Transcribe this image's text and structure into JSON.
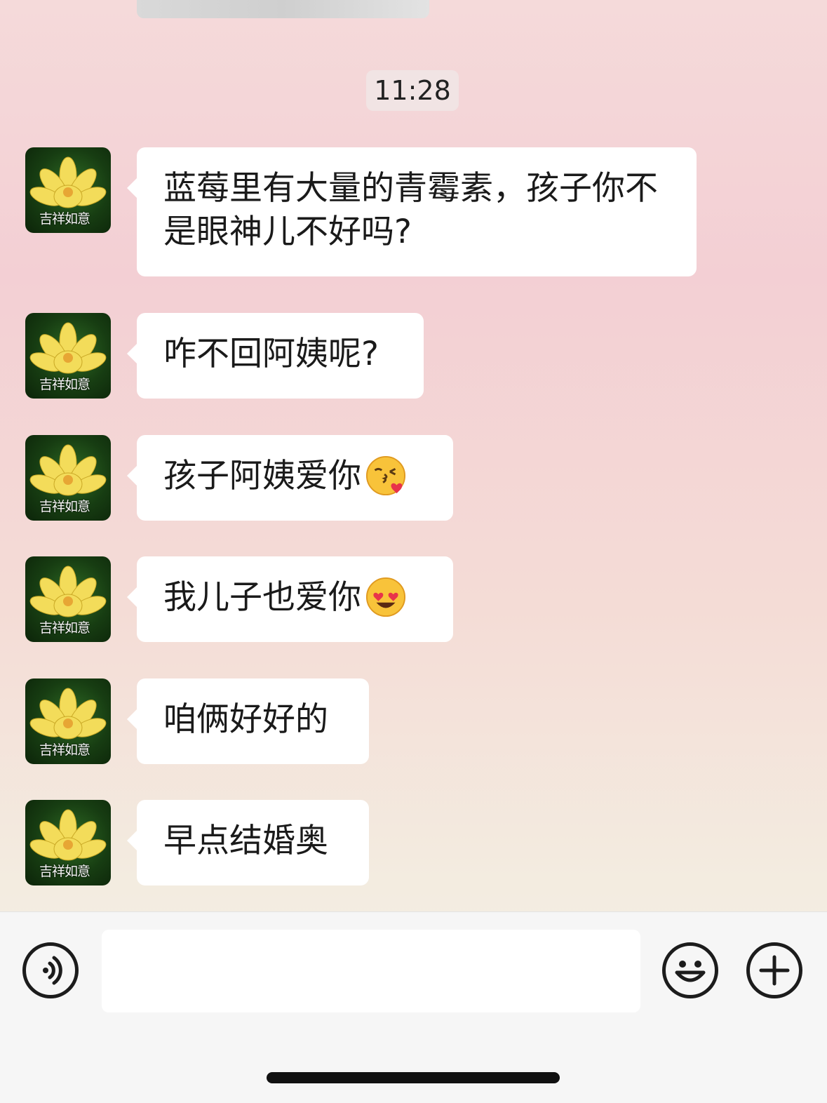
{
  "chat": {
    "timestamp": "11:28",
    "messages": [
      {
        "sender_avatar_caption": "吉祥如意",
        "text": "蓝莓里有大量的青霉素，孩子你不是眼神儿不好吗?",
        "emoji": ""
      },
      {
        "sender_avatar_caption": "吉祥如意",
        "text": "咋不回阿姨呢?",
        "emoji": ""
      },
      {
        "sender_avatar_caption": "吉祥如意",
        "text": "孩子阿姨爱你",
        "emoji": "kissing-face-emoji"
      },
      {
        "sender_avatar_caption": "吉祥如意",
        "text": "我儿子也爱你",
        "emoji": "heart-eyes-emoji"
      },
      {
        "sender_avatar_caption": "吉祥如意",
        "text": "咱俩好好的",
        "emoji": ""
      },
      {
        "sender_avatar_caption": "吉祥如意",
        "text": "早点结婚奥",
        "emoji": ""
      }
    ]
  },
  "input_bar": {
    "voice_icon": "voice-icon",
    "emoji_icon": "smiley-icon",
    "plus_icon": "plus-icon",
    "input_value": "",
    "input_placeholder": ""
  },
  "colors": {
    "bubble": "#ffffff",
    "input_bar": "#f6f6f6",
    "avatar_flower": "#f3dc5a"
  }
}
